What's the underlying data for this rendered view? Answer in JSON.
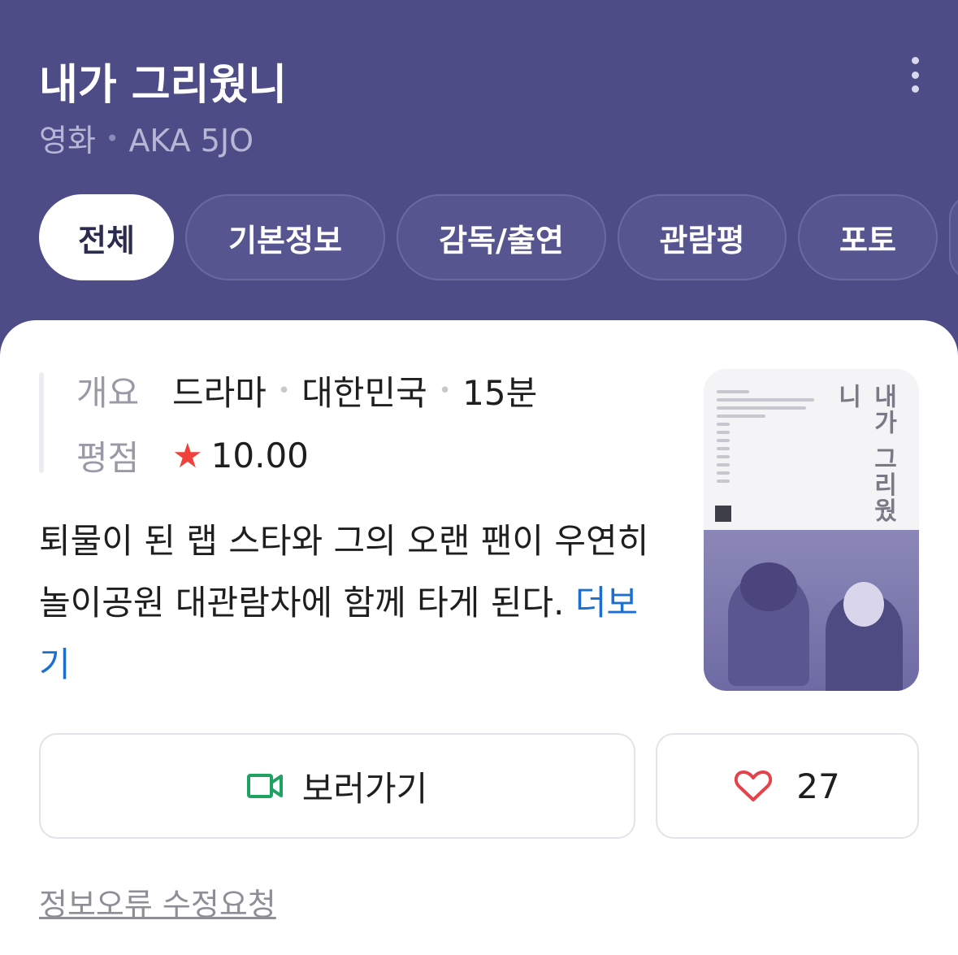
{
  "header": {
    "title": "내가 그리웠니",
    "category": "영화",
    "aka": "AKA 5JO",
    "background_color": "#4d4c86"
  },
  "tabs": [
    {
      "label": "전체",
      "active": true
    },
    {
      "label": "기본정보",
      "active": false
    },
    {
      "label": "감독/출연",
      "active": false
    },
    {
      "label": "관람평",
      "active": false
    },
    {
      "label": "포토",
      "active": false
    }
  ],
  "info": {
    "overview_label": "개요",
    "genre": "드라마",
    "country": "대한민국",
    "runtime": "15분",
    "rating_label": "평점",
    "rating": "10.00"
  },
  "synopsis": {
    "text": "퇴물이 된 랩 스타와 그의 오랜 팬이 우연히 놀이공원 대관람차에 함께 타게 된다.",
    "more_label": "더보기"
  },
  "poster": {
    "vertical_title": "내가 그리웠니"
  },
  "actions": {
    "watch_label": "보러가기",
    "like_count": "27"
  },
  "footer": {
    "report_label": "정보오류 수정요청"
  },
  "colors": {
    "accent_link": "#1a6fd1",
    "star": "#f0413a",
    "watch_icon": "#1ea362",
    "heart_icon": "#e5434b"
  }
}
